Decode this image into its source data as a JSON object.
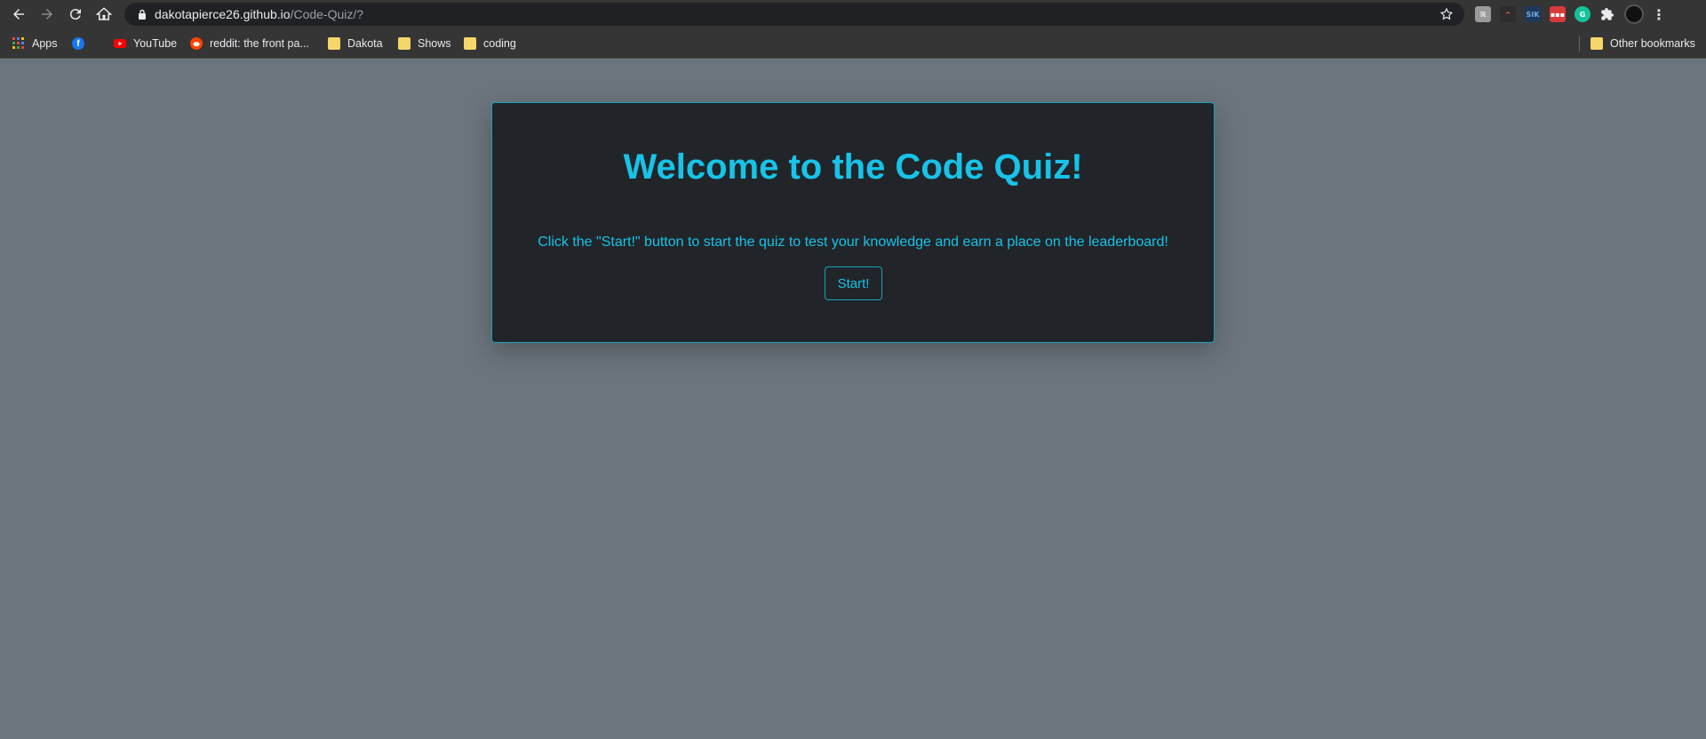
{
  "browser": {
    "url_host": "dakotapierce26.github.io",
    "url_path": "/Code-Quiz/?",
    "extensions": [
      "ext-keepa-icon",
      "ext-orange-icon",
      "ext-sik-icon",
      "ext-red-icon",
      "grammarly-icon",
      "extensions-puzzle-icon"
    ],
    "ext_labels": {
      "sik": "SIK",
      "red": "▪▪▪"
    },
    "bookmarks": [
      {
        "label": "Apps",
        "icon": "apps-grid-icon"
      },
      {
        "label": "",
        "icon": "facebook-icon"
      },
      {
        "label": "YouTube",
        "icon": "youtube-icon"
      },
      {
        "label": "reddit: the front pa...",
        "icon": "reddit-icon"
      },
      {
        "label": "Dakota",
        "icon": "folder-icon"
      },
      {
        "label": "Shows",
        "icon": "folder-icon"
      },
      {
        "label": "coding",
        "icon": "folder-icon"
      }
    ],
    "other_bookmarks": "Other bookmarks"
  },
  "quiz": {
    "title": "Welcome to the Code Quiz!",
    "description": "Click the \"Start!\" button to start the quiz to test your knowledge and earn a place on the leaderboard!",
    "start_label": "Start!"
  },
  "colors": {
    "page_bg": "#6c757d",
    "card_bg": "#212529",
    "accent": "#17c3e8"
  }
}
